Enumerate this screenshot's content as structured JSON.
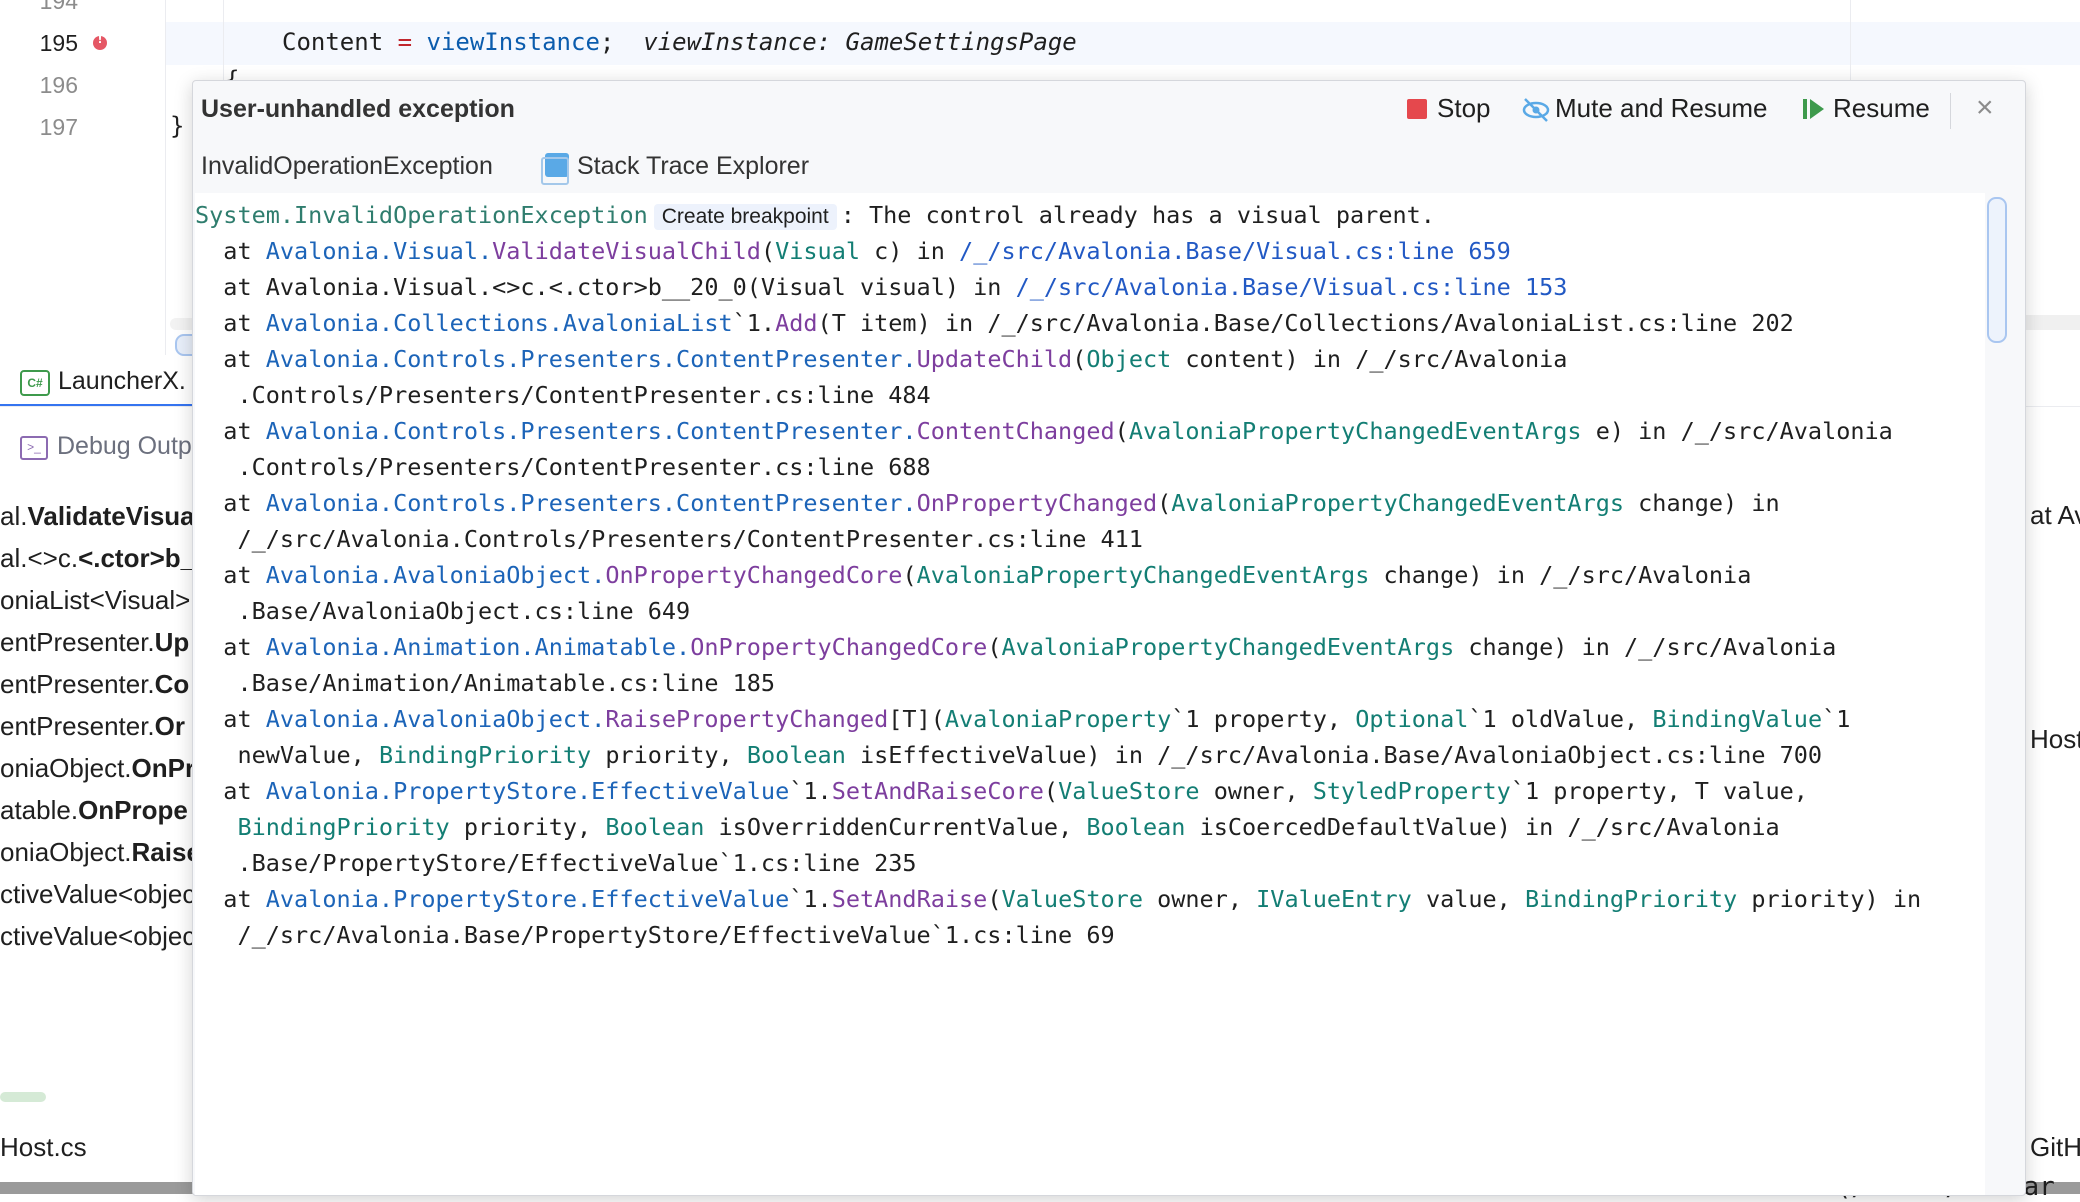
{
  "editor": {
    "line_numbers": [
      "194",
      "195",
      "196",
      "197"
    ],
    "code_line_195_a": "Content ",
    "code_line_195_op": "=",
    "code_line_195_b": " viewInstance",
    "code_line_195_c": ";  ",
    "inlay_hint": "viewInstance: GameSettingsPage",
    "code_line_196": "{",
    "code_line_197": "}"
  },
  "file_tab": {
    "label": "LauncherX."
  },
  "debug_panel": {
    "label": "Debug Outp",
    "frames": [
      {
        "pre": "al.",
        "bold": "ValidateVisua"
      },
      {
        "pre": "al.<>c.",
        "bold": "<.ctor>b_"
      },
      {
        "pre": "oniaList<Visual>",
        "bold": ""
      },
      {
        "pre": "entPresenter.",
        "bold": "Up"
      },
      {
        "pre": "entPresenter.",
        "bold": "Co"
      },
      {
        "pre": "entPresenter.",
        "bold": "Or"
      },
      {
        "pre": "oniaObject.",
        "bold": "OnPr"
      },
      {
        "pre": "atable.",
        "bold": "OnPrope"
      },
      {
        "pre": "oniaObject.",
        "bold": "Raise"
      },
      {
        "pre": "ctiveValue<objec",
        "bold": ""
      },
      {
        "pre": "ctiveValue<objec",
        "bold": ""
      }
    ],
    "host_tab": "Host.cs",
    "right_fragments": [
      "at Av",
      "HostS",
      "GitHu"
    ],
    "bottom_text": "c constructor was found (/Users/laolar"
  },
  "popup": {
    "title": "User-unhandled exception",
    "stop_label": "Stop",
    "mute_label": "Mute and Resume",
    "resume_label": "Resume",
    "close_symbol": "×",
    "exception_type": "InvalidOperationException",
    "stack_trace_explorer": "Stack Trace Explorer",
    "create_breakpoint": "Create breakpoint",
    "colors": {
      "stop": "#e5484d",
      "resume": "#3e9a4c",
      "link": "#2259c4"
    }
  },
  "trace": {
    "l1": {
      "a": "System.InvalidOperationException",
      "b": ": The control already has a visual parent."
    },
    "l2": {
      "at": "  at ",
      "ns": "Avalonia.Visual.",
      "m": "ValidateVisualChild",
      "p1": "(",
      "t1": "Visual",
      "p2": " c) in ",
      "link": "/_/src/Avalonia.Base/Visual.cs:line 659"
    },
    "l3": {
      "text": "  at Avalonia.Visual.<>c.<.ctor>b__20_0(Visual visual) in ",
      "link": "/_/src/Avalonia.Base/Visual.cs:line 153"
    },
    "l4": {
      "at": "  at ",
      "ns": "Avalonia.Collections.AvaloniaList",
      "rest1": "`1.",
      "m": "Add",
      "rest2": "(T item) in /_/src/Avalonia.Base/Collections/AvaloniaList.cs:line 202"
    },
    "l5": {
      "at": "  at ",
      "ns": "Avalonia.Controls.Presenters.ContentPresenter.",
      "m": "UpdateChild",
      "p1": "(",
      "t1": "Object",
      "p2": " content) in /_/src/Avalonia"
    },
    "l6": "   .Controls/Presenters/ContentPresenter.cs:line 484",
    "l7": {
      "at": "  at ",
      "ns": "Avalonia.Controls.Presenters.ContentPresenter.",
      "m": "ContentChanged",
      "p1": "(",
      "t1": "AvaloniaPropertyChangedEventArgs",
      "p2": " e) in /_/src/Avalonia"
    },
    "l8": "   .Controls/Presenters/ContentPresenter.cs:line 688",
    "l9": {
      "at": "  at ",
      "ns": "Avalonia.Controls.Presenters.ContentPresenter.",
      "m": "OnPropertyChanged",
      "p1": "(",
      "t1": "AvaloniaPropertyChangedEventArgs",
      "p2": " change) in"
    },
    "l10": "   /_/src/Avalonia.Controls/Presenters/ContentPresenter.cs:line 411",
    "l11": {
      "at": "  at ",
      "ns": "Avalonia.AvaloniaObject.",
      "m": "OnPropertyChangedCore",
      "p1": "(",
      "t1": "AvaloniaPropertyChangedEventArgs",
      "p2": " change) in /_/src/Avalonia"
    },
    "l12": "   .Base/AvaloniaObject.cs:line 649",
    "l13": {
      "at": "  at ",
      "ns": "Avalonia.Animation.Animatable.",
      "m": "OnPropertyChangedCore",
      "p1": "(",
      "t1": "AvaloniaPropertyChangedEventArgs",
      "p2": " change) in /_/src/Avalonia"
    },
    "l14": "   .Base/Animation/Animatable.cs:line 185",
    "l15": {
      "at": "  at ",
      "ns": "Avalonia.AvaloniaObject.",
      "m": "RaisePropertyChanged",
      "a1": "[T](",
      "t1": "AvaloniaProperty",
      "a2": "`1 property, ",
      "t2": "Optional",
      "a3": "`1 oldValue, ",
      "t3": "BindingValue",
      "a4": "`1"
    },
    "l16": {
      "a0": "   newValue, ",
      "t1": "BindingPriority",
      "a1": " priority, ",
      "t2": "Boolean",
      "a2": " isEffectiveValue) in /_/src/Avalonia.Base/AvaloniaObject.cs:line 700"
    },
    "l17": {
      "at": "  at ",
      "ns": "Avalonia.PropertyStore.EffectiveValue",
      "r1": "`1.",
      "m": "SetAndRaiseCore",
      "p1": "(",
      "t1": "ValueStore",
      "a1": " owner, ",
      "t2": "StyledProperty",
      "a2": "`1 property, T value,"
    },
    "l18": {
      "a0": "   ",
      "t1": "BindingPriority",
      "a1": " priority, ",
      "t2": "Boolean",
      "a2": " isOverriddenCurrentValue, ",
      "t3": "Boolean",
      "a3": " isCoercedDefaultValue) in /_/src/Avalonia"
    },
    "l19": "   .Base/PropertyStore/EffectiveValue`1.cs:line 235",
    "l20": {
      "at": "  at ",
      "ns": "Avalonia.PropertyStore.EffectiveValue",
      "r1": "`1.",
      "m": "SetAndRaise",
      "p1": "(",
      "t1": "ValueStore",
      "a1": " owner, ",
      "t2": "IValueEntry",
      "a2": " value, ",
      "t3": "BindingPriority",
      "a3": " priority) in"
    },
    "l21": "   /_/src/Avalonia.Base/PropertyStore/EffectiveValue`1.cs:line 69"
  }
}
